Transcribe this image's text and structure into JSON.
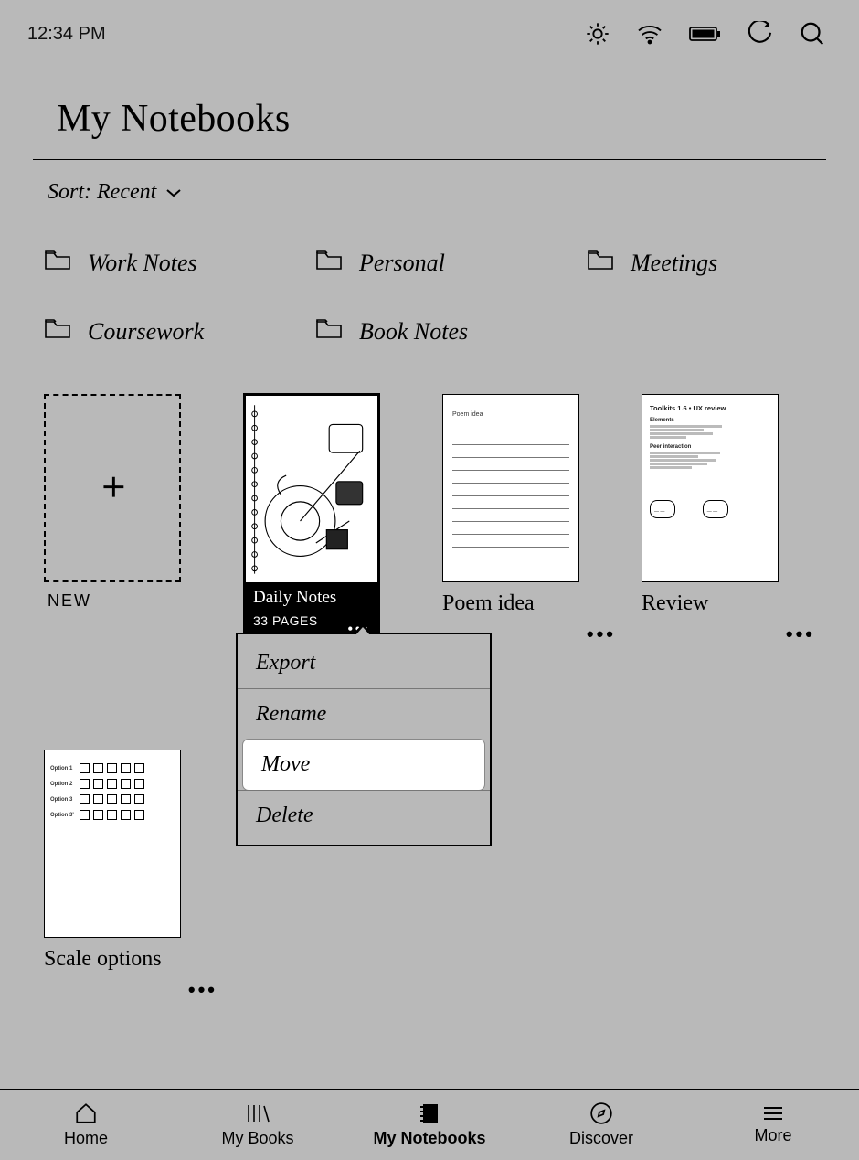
{
  "status": {
    "time": "12:34 PM"
  },
  "title": "My Notebooks",
  "sort": {
    "label": "Sort: Recent"
  },
  "folders": [
    {
      "name": "Work Notes"
    },
    {
      "name": "Personal"
    },
    {
      "name": "Meetings"
    },
    {
      "name": "Coursework"
    },
    {
      "name": "Book Notes"
    }
  ],
  "notebooks": {
    "new_label": "NEW",
    "selected": {
      "title": "Daily Notes",
      "pages_label": "33 PAGES"
    },
    "items": [
      {
        "title": "Poem idea"
      },
      {
        "title": "Review",
        "cover_title": "Toolkits 1.6 • UX review"
      },
      {
        "title": "Scale options"
      }
    ]
  },
  "context_menu": {
    "items": [
      {
        "label": "Export"
      },
      {
        "label": "Rename"
      },
      {
        "label": "Move",
        "highlighted": true
      },
      {
        "label": "Delete"
      }
    ]
  },
  "nav": {
    "home": "Home",
    "mybooks": "My Books",
    "notebooks": "My Notebooks",
    "discover": "Discover",
    "more": "More"
  }
}
